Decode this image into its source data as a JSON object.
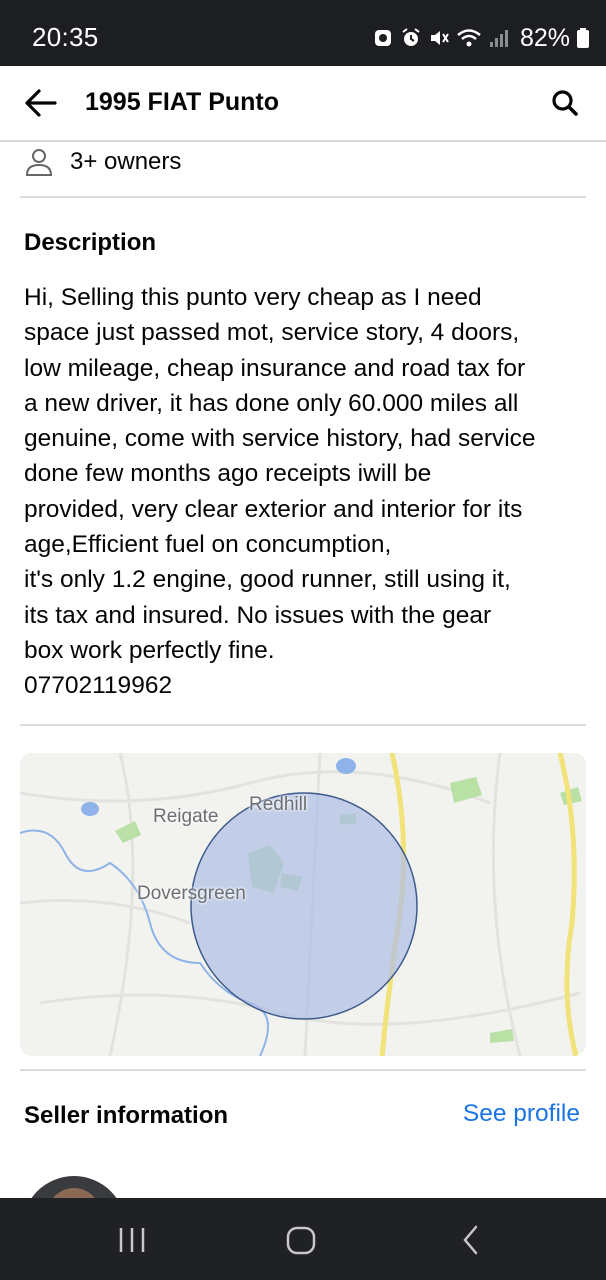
{
  "status_bar": {
    "time": "20:35",
    "battery": "82%",
    "icons": [
      "notification-icon",
      "alarm-icon",
      "mute-icon",
      "wifi-icon",
      "signal-icon",
      "battery-icon"
    ]
  },
  "header": {
    "title": "1995 FIAT Punto",
    "back_icon": "back-arrow-icon",
    "search_icon": "search-icon"
  },
  "details": {
    "owners": "3+ owners",
    "owners_icon": "person-icon"
  },
  "description": {
    "heading": "Description",
    "lines": [
      "Hi, Selling this punto very cheap as I need",
      "space just passed mot, service story, 4 doors,",
      "low mileage, cheap insurance and road tax for",
      "a new driver, it has done only 60.000 miles all",
      "genuine, come with service history, had service",
      "done few months ago receipts iwill be",
      "provided, very clear exterior and interior for its",
      "age,Efficient fuel on concumption,",
      "it's only 1.2 engine, good runner, still using it,",
      "its tax and insured. No issues with the gear",
      "box work perfectly fine.",
      "07702119962"
    ]
  },
  "map": {
    "labels": [
      "Reigate",
      "Redhill",
      "Doversgreen"
    ],
    "colors": {
      "radius": "#aebde6",
      "radius_border": "#3c5a8a",
      "road": "#f2e27a",
      "water": "#8fb3e8",
      "park": "#b9e0a5"
    }
  },
  "seller": {
    "heading": "Seller information",
    "see_profile": "See profile",
    "link_color": "#1b74e4"
  },
  "nav_bar": {
    "icons": [
      "recent-apps-icon",
      "home-icon",
      "back-icon"
    ]
  }
}
